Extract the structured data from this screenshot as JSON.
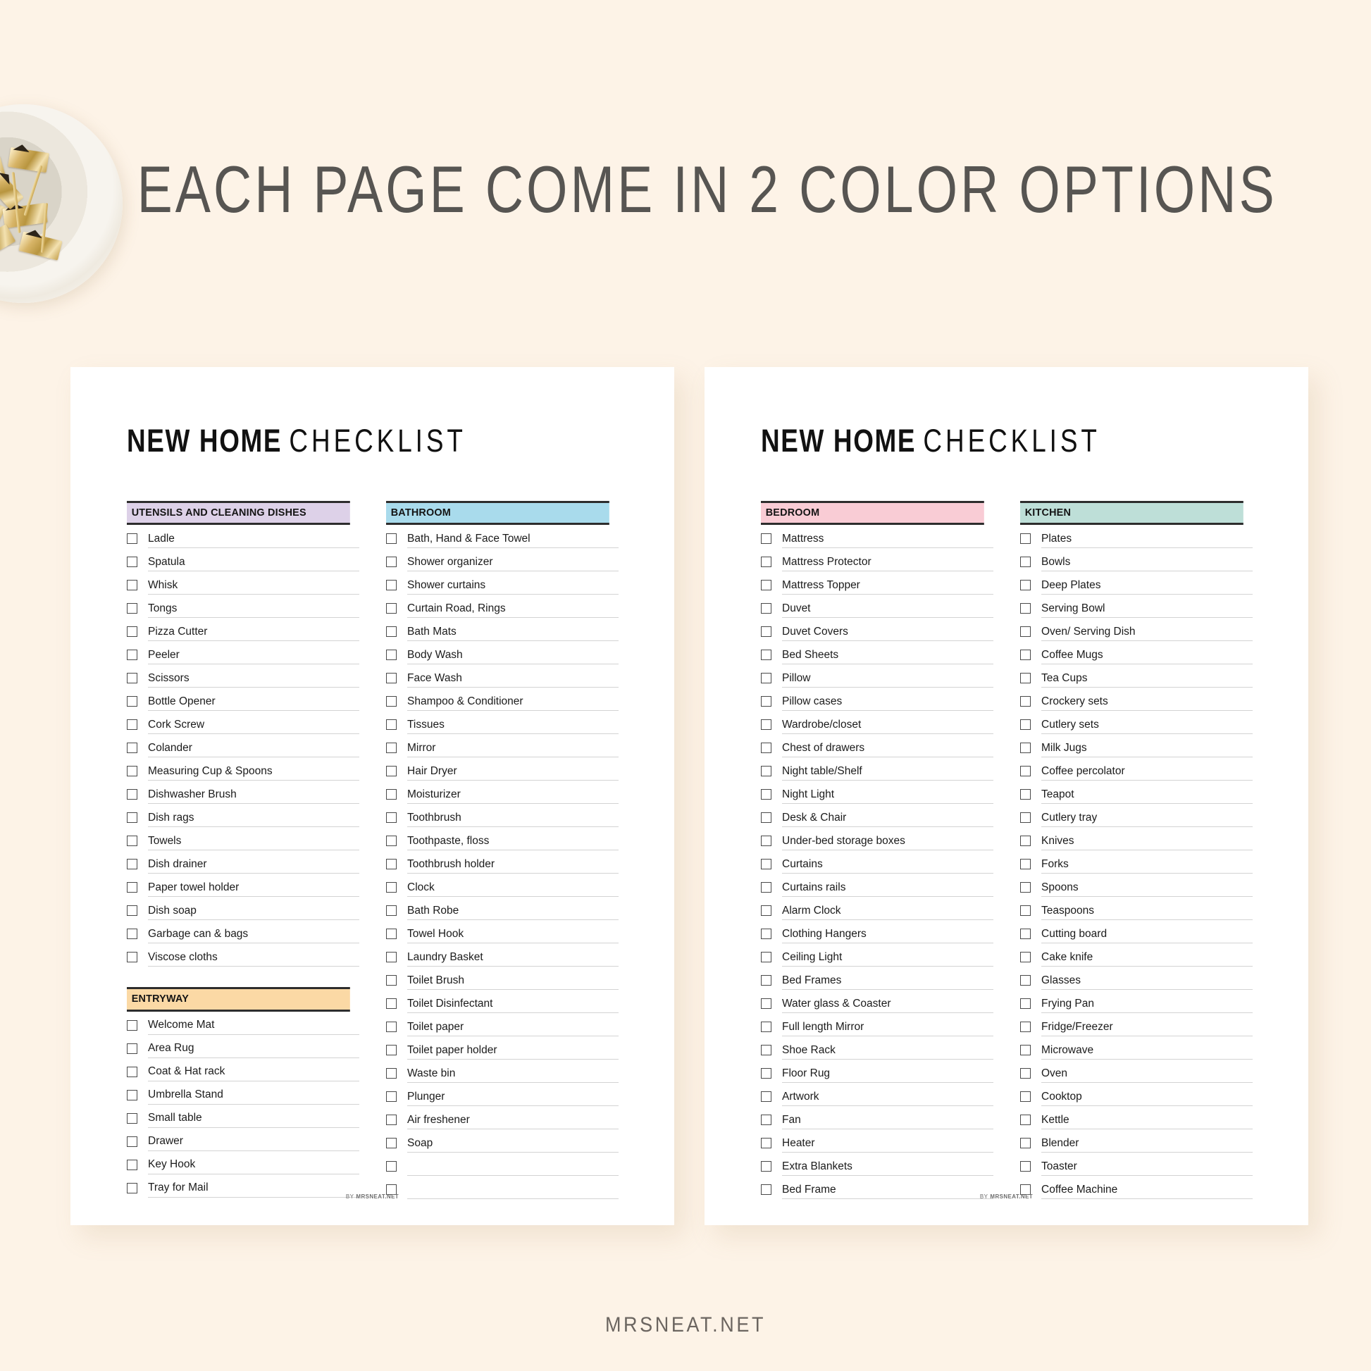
{
  "headline": "EACH PAGE COME IN 2 COLOR OPTIONS",
  "bottom_brand": "MRSNEAT.NET",
  "card_footer": {
    "by": "BY",
    "brand": "MRSNEAT.NET"
  },
  "background_color": "#fdf3e7",
  "card_title": {
    "bold": "NEW HOME",
    "light": "CHECKLIST"
  },
  "pages": [
    {
      "name": "left-page",
      "title": {
        "bold": "NEW HOME",
        "light": "CHECKLIST"
      },
      "columns": [
        {
          "name": "left-column",
          "sections": [
            {
              "heading": "UTENSILS AND CLEANING DISHES",
              "color": "#ddd1e8",
              "items": [
                "Ladle",
                "Spatula",
                "Whisk",
                "Tongs",
                "Pizza Cutter",
                "Peeler",
                "Scissors",
                "Bottle Opener",
                "Cork Screw",
                "Colander",
                "Measuring Cup & Spoons",
                "Dishwasher Brush",
                "Dish rags",
                "Towels",
                "Dish drainer",
                "Paper towel holder",
                "Dish soap",
                "Garbage can & bags",
                "Viscose cloths"
              ]
            },
            {
              "heading": "ENTRYWAY",
              "color": "#fbd9a5",
              "items": [
                "Welcome Mat",
                "Area Rug",
                "Coat & Hat rack",
                "Umbrella Stand",
                "Small table",
                "Drawer",
                "Key Hook",
                "Tray for Mail"
              ]
            }
          ]
        },
        {
          "name": "right-column",
          "sections": [
            {
              "heading": "BATHROOM",
              "color": "#a9dbec",
              "items": [
                "Bath, Hand & Face Towel",
                "Shower organizer",
                "Shower curtains",
                "Curtain Road, Rings",
                "Bath Mats",
                "Body Wash",
                "Face Wash",
                "Shampoo & Conditioner",
                "Tissues",
                "Mirror",
                "Hair Dryer",
                "Moisturizer",
                "Toothbrush",
                "Toothpaste, floss",
                "Toothbrush holder",
                "Clock",
                "Bath Robe",
                "Towel Hook",
                "Laundry Basket",
                "Toilet Brush",
                "Toilet Disinfectant",
                "Toilet paper",
                "Toilet paper holder",
                "Waste bin",
                "Plunger",
                "Air freshener",
                "Soap",
                "",
                ""
              ]
            }
          ]
        }
      ]
    },
    {
      "name": "right-page",
      "title": {
        "bold": "NEW HOME",
        "light": "CHECKLIST"
      },
      "columns": [
        {
          "name": "left-column",
          "sections": [
            {
              "heading": "BEDROOM",
              "color": "#f9ccd5",
              "items": [
                "Mattress",
                "Mattress Protector",
                "Mattress Topper",
                "Duvet",
                "Duvet Covers",
                "Bed Sheets",
                "Pillow",
                "Pillow cases",
                "Wardrobe/closet",
                "Chest of drawers",
                "Night table/Shelf",
                "Night Light",
                "Desk & Chair",
                "Under-bed storage boxes",
                "Curtains",
                "Curtains rails",
                "Alarm Clock",
                "Clothing Hangers",
                "Ceiling Light",
                "Bed Frames",
                "Water glass & Coaster",
                "Full length Mirror",
                "Shoe Rack",
                "Floor Rug",
                "Artwork",
                "Fan",
                "Heater",
                "Extra Blankets",
                "Bed Frame"
              ]
            }
          ]
        },
        {
          "name": "right-column",
          "sections": [
            {
              "heading": "KITCHEN",
              "color": "#bedfd8",
              "items": [
                "Plates",
                "Bowls",
                "Deep Plates",
                "Serving Bowl",
                "Oven/ Serving Dish",
                "Coffee Mugs",
                "Tea Cups",
                "Crockery sets",
                "Cutlery sets",
                "Milk Jugs",
                "Coffee percolator",
                "Teapot",
                "Cutlery tray",
                "Knives",
                "Forks",
                "Spoons",
                "Teaspoons",
                "Cutting board",
                "Cake knife",
                "Glasses",
                "Frying Pan",
                "Fridge/Freezer",
                "Microwave",
                "Oven",
                "Cooktop",
                "Kettle",
                "Blender",
                "Toaster",
                "Coffee Machine"
              ]
            }
          ]
        }
      ]
    }
  ]
}
